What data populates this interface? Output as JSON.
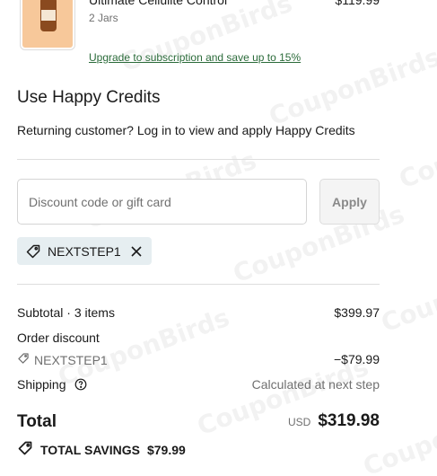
{
  "watermark": "CouponBirds",
  "product": {
    "name": "Ultimate Cellulite Control",
    "variant": "2 Jars",
    "price": "$119.99",
    "upgrade_link": "Upgrade to subscription and save up to 15%"
  },
  "credits": {
    "title": "Use Happy Credits",
    "subtitle": "Returning customer? Log in to view and apply Happy Credits"
  },
  "discount": {
    "placeholder": "Discount code or gift card",
    "apply_label": "Apply",
    "applied_code": "NEXTSTEP1"
  },
  "summary": {
    "subtotal_label": "Subtotal · 3 items",
    "subtotal_value": "$399.97",
    "order_discount_label": "Order discount",
    "discount_code": "NEXTSTEP1",
    "discount_value": "−$79.99",
    "shipping_label": "Shipping",
    "shipping_value": "Calculated at next step",
    "total_label": "Total",
    "currency": "USD",
    "total_value": "$319.98",
    "savings_label": "TOTAL SAVINGS",
    "savings_value": "$79.99"
  },
  "colors": {
    "link_green": "#2b6b3a",
    "pill_bg": "#e6eef1",
    "divider": "#dedede"
  },
  "icons": [
    "tag-icon",
    "close-icon",
    "info-icon"
  ]
}
